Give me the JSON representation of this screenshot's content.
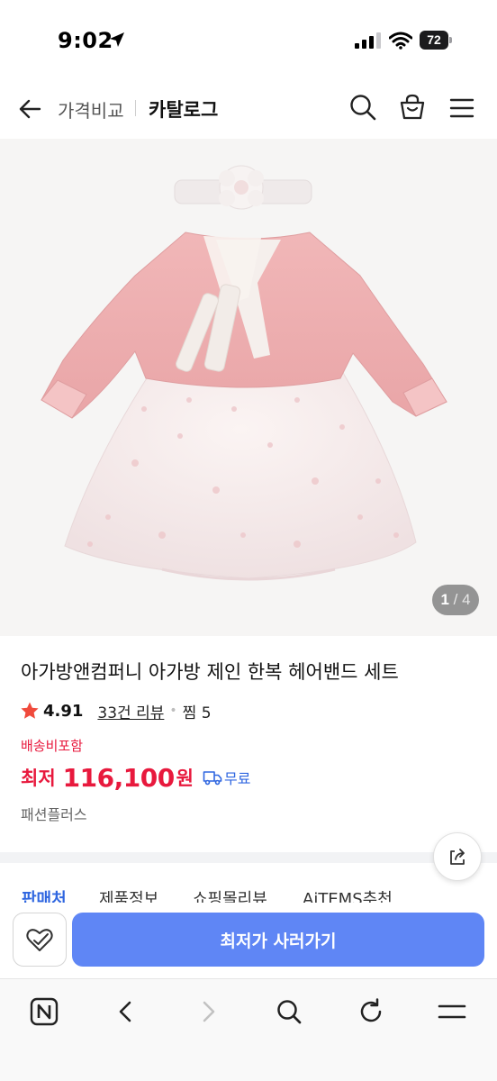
{
  "status_bar": {
    "time": "9:02",
    "battery": "72"
  },
  "header": {
    "breadcrumb_1": "가격비교",
    "breadcrumb_2": "카탈로그"
  },
  "product": {
    "image_counter_current": "1",
    "image_counter_total": "/ 4",
    "title": "아가방앤컴퍼니 아가방 제인 한복 헤어밴드 세트",
    "rating": "4.91",
    "review_link": "33건 리뷰",
    "zzim": "찜 5",
    "shipping_included": "배송비포함",
    "price_label": "최저",
    "price_value": "116,100",
    "price_unit": "원",
    "free_shipping": "무료",
    "shop": "패션플러스"
  },
  "tabs": [
    {
      "label": "판매처"
    },
    {
      "label": "제품정보"
    },
    {
      "label": "쇼핑몰리뷰"
    },
    {
      "label": "AiTEMS추천"
    }
  ],
  "purchase_bar": {
    "buy_label": "최저가 사러가기"
  },
  "colors": {
    "accent_blue": "#2f66e0",
    "buy_button": "#5f86f5",
    "price_red": "#e8193d",
    "star": "#f04a3c"
  },
  "icons": [
    "back-arrow-icon",
    "search-icon",
    "cart-icon",
    "menu-icon",
    "star-icon",
    "truck-icon",
    "share-icon",
    "heart-check-icon",
    "naver-n-icon",
    "chevron-left-icon",
    "chevron-right-icon",
    "refresh-icon"
  ]
}
